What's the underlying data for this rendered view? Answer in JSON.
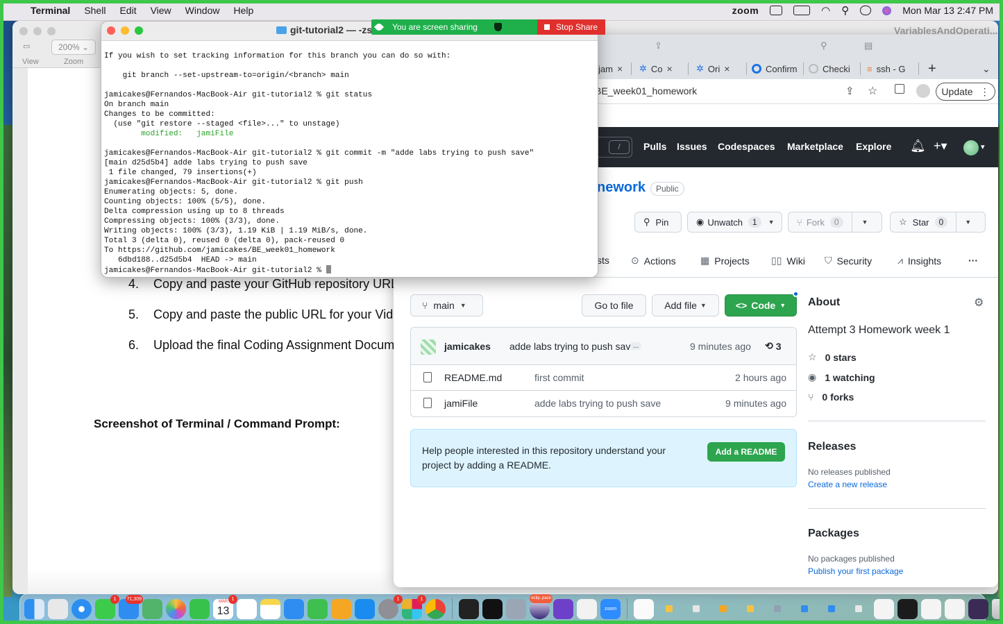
{
  "menubar": {
    "app": "Terminal",
    "items": [
      "Shell",
      "Edit",
      "View",
      "Window",
      "Help"
    ],
    "zoom_label": "zoom",
    "datetime": "Mon Mar 13  2:47 PM"
  },
  "doc_window": {
    "zoom_value": "200%",
    "view_label": "View",
    "zoom_label": "Zoom",
    "title_right": "VariablesAndOperati...",
    "list": [
      {
        "n": "4.",
        "text": "Copy and paste your GitHub repository URL"
      },
      {
        "n": "5.",
        "text": "Copy and paste the public URL for your Vid"
      },
      {
        "n": "6.",
        "text": "Upload the final Coding Assignment Docum"
      }
    ],
    "heading": "Screenshot of Terminal / Command Prompt:"
  },
  "terminal": {
    "title": "git-tutorial2 — -zs",
    "lines": [
      {
        "text": "If you wish to set tracking information for this branch you can do so with:",
        "green": false
      },
      {
        "text": "",
        "green": false
      },
      {
        "text": "    git branch --set-upstream-to=origin/<branch> main",
        "green": false
      },
      {
        "text": "",
        "green": false
      },
      {
        "text": "jamicakes@Fernandos-MacBook-Air git-tutorial2 % git status",
        "green": false
      },
      {
        "text": "On branch main",
        "green": false
      },
      {
        "text": "Changes to be committed:",
        "green": false
      },
      {
        "text": "  (use \"git restore --staged <file>...\" to unstage)",
        "green": false
      },
      {
        "text": "        modified:   jamiFile",
        "green": true
      },
      {
        "text": "",
        "green": false
      },
      {
        "text": "jamicakes@Fernandos-MacBook-Air git-tutorial2 % git commit -m \"adde labs trying to push save\"",
        "green": false
      },
      {
        "text": "[main d25d5b4] adde labs trying to push save",
        "green": false
      },
      {
        "text": " 1 file changed, 79 insertions(+)",
        "green": false
      },
      {
        "text": "jamicakes@Fernandos-MacBook-Air git-tutorial2 % git push",
        "green": false
      },
      {
        "text": "Enumerating objects: 5, done.",
        "green": false
      },
      {
        "text": "Counting objects: 100% (5/5), done.",
        "green": false
      },
      {
        "text": "Delta compression using up to 8 threads",
        "green": false
      },
      {
        "text": "Compressing objects: 100% (3/3), done.",
        "green": false
      },
      {
        "text": "Writing objects: 100% (3/3), 1.19 KiB | 1.19 MiB/s, done.",
        "green": false
      },
      {
        "text": "Total 3 (delta 0), reused 0 (delta 0), pack-reused 0",
        "green": false
      },
      {
        "text": "To https://github.com/jamicakes/BE_week01_homework",
        "green": false
      },
      {
        "text": "   6dbd188..d25d5b4  HEAD -> main",
        "green": false
      }
    ],
    "prompt": "jamicakes@Fernandos-MacBook-Air git-tutorial2 % "
  },
  "screen_share": {
    "status": "You are screen sharing",
    "stop_label": "Stop Share"
  },
  "browser": {
    "tabs": [
      {
        "label": "jam",
        "close": "×"
      },
      {
        "label": "Co",
        "close": "×"
      },
      {
        "label": "Ori",
        "close": "×"
      },
      {
        "label": "Confirm",
        "close": ""
      },
      {
        "label": "Checki",
        "close": ""
      },
      {
        "label": "ssh - G",
        "close": ""
      }
    ],
    "new_tab": "+",
    "tab_menu": "⌄",
    "url": "BE_week01_homework",
    "update_label": "Update"
  },
  "github": {
    "slash": "/",
    "nav": [
      "Pulls",
      "Issues",
      "Codespaces",
      "Marketplace",
      "Explore"
    ],
    "repo_name": "nework",
    "visibility": "Public",
    "pin_label": "Pin",
    "unwatch_label": "Unwatch",
    "unwatch_count": "1",
    "fork_label": "Fork",
    "fork_count": "0",
    "star_label": "Star",
    "star_count": "0",
    "tabs": [
      "sts",
      "Actions",
      "Projects",
      "Wiki",
      "Security",
      "Insights"
    ],
    "more": "···",
    "branch": "main",
    "goto_file": "Go to file",
    "add_file": "Add file",
    "code": "Code",
    "commit": {
      "author": "jamicakes",
      "message": "adde labs trying to push save",
      "more": "...",
      "time": "9 minutes ago",
      "count": "3"
    },
    "files": [
      {
        "name": "README.md",
        "message": "first commit",
        "time": "2 hours ago"
      },
      {
        "name": "jamiFile",
        "message": "adde labs trying to push save",
        "time": "9 minutes ago"
      }
    ],
    "readme_prompt": "Help people interested in this repository understand your project by adding a README.",
    "readme_button": "Add a README",
    "about": {
      "heading": "About",
      "description": "Attempt 3 Homework week 1",
      "stars": "0 stars",
      "watching": "1 watching",
      "forks": "0 forks"
    },
    "releases": {
      "heading": "Releases",
      "none": "No releases published",
      "link": "Create a new release"
    },
    "packages": {
      "heading": "Packages",
      "none": "No packages published",
      "link": "Publish your first package"
    }
  },
  "dock": {
    "calendar_day": "13",
    "calendar_month": "MAR",
    "badges": {
      "messages": "1",
      "mail": "71,309",
      "calendar": "1",
      "settings": "1",
      "slack": "1"
    },
    "zoom_label": "zoom",
    "eclipse_label": "eclip..pace"
  },
  "colors": {
    "share_green": "#1fb04c",
    "stop_red": "#e0302e",
    "gh_header": "#24292f",
    "gh_green": "#2da44e",
    "gh_link": "#0969da"
  }
}
